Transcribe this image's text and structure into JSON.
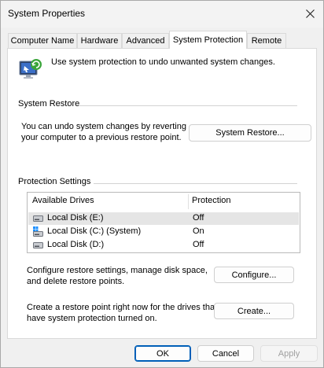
{
  "window": {
    "title": "System Properties"
  },
  "tabs": [
    {
      "label": "Computer Name"
    },
    {
      "label": "Hardware"
    },
    {
      "label": "Advanced"
    },
    {
      "label": "System Protection",
      "active": true
    },
    {
      "label": "Remote"
    }
  ],
  "intro": {
    "icon": "system-protection-icon",
    "text": "Use system protection to undo unwanted system changes."
  },
  "system_restore": {
    "group_title": "System Restore",
    "description_line1": "You can undo system changes by reverting",
    "description_line2": "your computer to a previous restore point.",
    "button_label": "System Restore..."
  },
  "protection_settings": {
    "group_title": "Protection Settings",
    "columns": [
      "Available Drives",
      "Protection"
    ],
    "drives": [
      {
        "name": "Local Disk (E:)",
        "protection": "Off",
        "icon": "hard-drive-icon",
        "selected": true
      },
      {
        "name": "Local Disk (C:) (System)",
        "protection": "On",
        "icon": "system-drive-icon"
      },
      {
        "name": "Local Disk (D:)",
        "protection": "Off",
        "icon": "hard-drive-icon"
      }
    ],
    "configure_text_line1": "Configure restore settings, manage disk space,",
    "configure_text_line2": "and delete restore points.",
    "configure_button": "Configure...",
    "create_text_line1": "Create a restore point right now for the drives that",
    "create_text_line2": "have system protection turned on.",
    "create_button": "Create..."
  },
  "footer": {
    "ok": "OK",
    "cancel": "Cancel",
    "apply": "Apply"
  },
  "colors": {
    "accent": "#005fb8",
    "selected_row": "#e5e5e5",
    "disabled_text": "#a0a0a0"
  }
}
